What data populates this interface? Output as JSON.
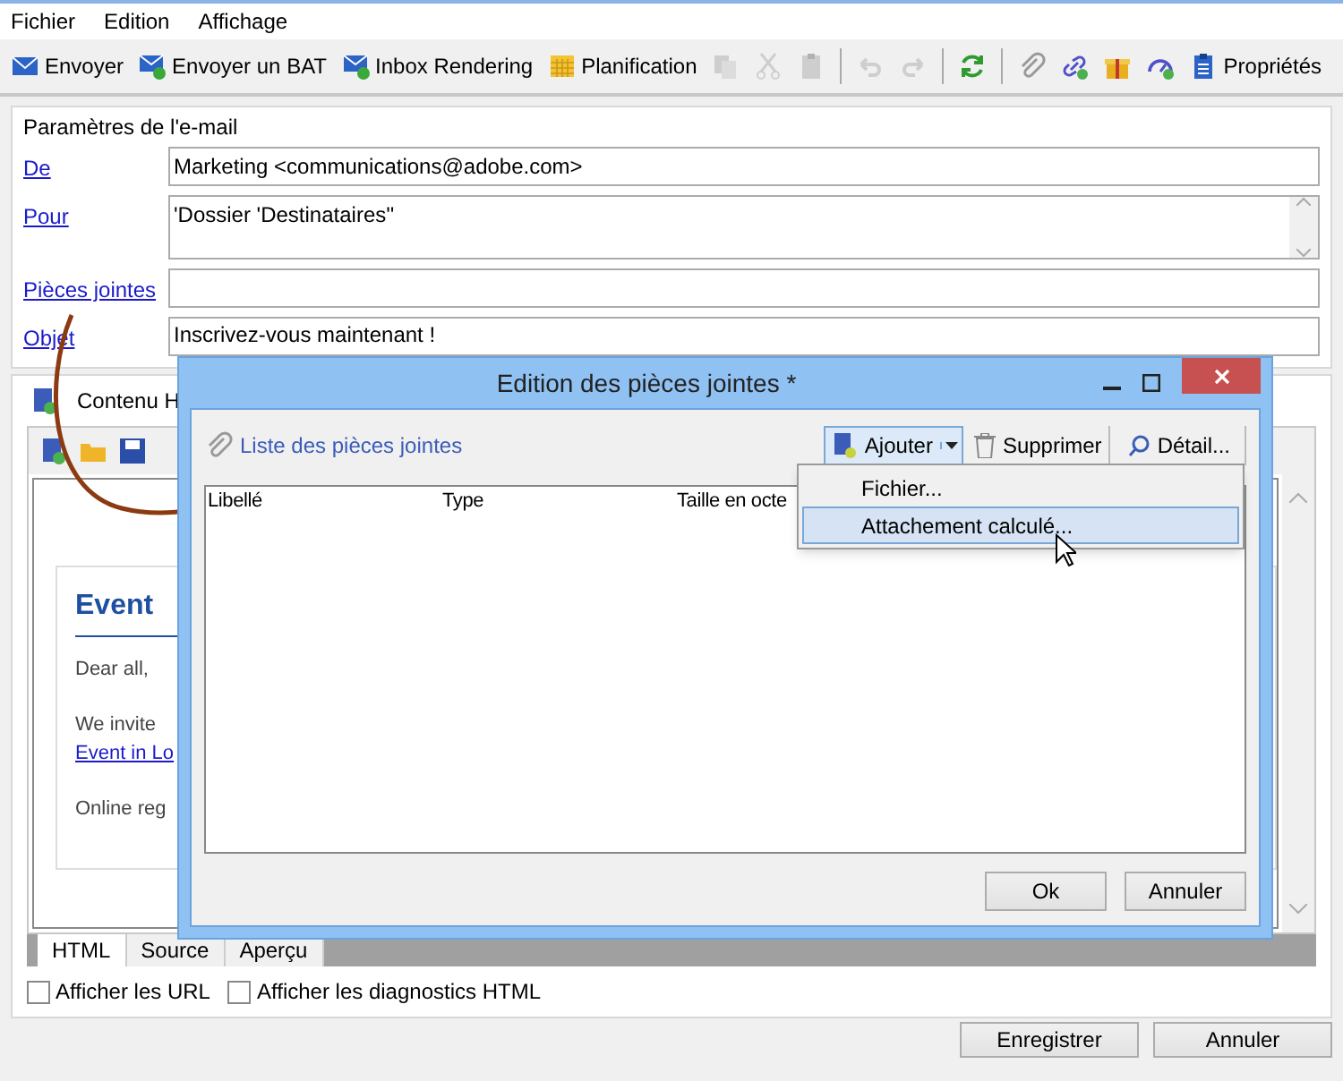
{
  "menu": [
    "Fichier",
    "Edition",
    "Affichage"
  ],
  "toolbar": [
    {
      "kind": "text",
      "label": "Envoyer"
    },
    {
      "kind": "text",
      "label": "Envoyer un BAT"
    },
    {
      "kind": "text",
      "label": "Inbox Rendering"
    },
    {
      "kind": "text",
      "label": "Planification"
    },
    {
      "kind": "icon",
      "disabled": true
    },
    {
      "kind": "icon",
      "disabled": true
    },
    {
      "kind": "icon",
      "disabled": true
    },
    {
      "kind": "sep"
    },
    {
      "kind": "icon",
      "disabled": true
    },
    {
      "kind": "icon",
      "disabled": true
    },
    {
      "kind": "sep"
    },
    {
      "kind": "icon",
      "disabled": false
    },
    {
      "kind": "sep"
    },
    {
      "kind": "icon",
      "disabled": false
    },
    {
      "kind": "icon",
      "disabled": false
    },
    {
      "kind": "icon",
      "disabled": false
    },
    {
      "kind": "icon",
      "disabled": false
    },
    {
      "kind": "text",
      "label": "Propriétés"
    }
  ],
  "params": {
    "title": "Paramètres de l'e-mail",
    "fields": [
      {
        "label": "De",
        "kind": "single",
        "value": "Marketing <communications@adobe.com>"
      },
      {
        "label": "Pour",
        "kind": "multi",
        "value": "'Dossier 'Destinataires''"
      },
      {
        "label": "Pièces jointes",
        "kind": "single"
      },
      {
        "label": "Objet",
        "kind": "single",
        "value": "Inscrivez-vous maintenant !"
      }
    ]
  },
  "content": {
    "tab": "Contenu H",
    "heading": "Event",
    "lines": [
      {
        "kind": "text",
        "text": "Dear all,"
      },
      {
        "kind": "text",
        "text": "We  invite"
      },
      {
        "kind": "link",
        "text": "Event in Lo"
      },
      {
        "kind": "text",
        "text": "Online reg"
      }
    ]
  },
  "view_tabs": [
    {
      "label": "HTML",
      "selected": true
    },
    {
      "label": "Source",
      "selected": false
    },
    {
      "label": "Aperçu",
      "selected": false
    }
  ],
  "checkboxes": [
    {
      "label": "Afficher les URL",
      "checked": false
    },
    {
      "label": "Afficher les diagnostics HTML",
      "checked": false
    }
  ],
  "buttons": [
    "Enregistrer",
    "Annuler"
  ],
  "dialog": {
    "title": "Edition des pièces jointes *",
    "list_label": "Liste des pièces jointes",
    "actions": [
      "Ajouter",
      "Supprimer",
      "Détail..."
    ],
    "columns": [
      "Libellé",
      "Type",
      "Taille en octe"
    ],
    "menu": [
      {
        "label": "Fichier...",
        "selected": false
      },
      {
        "label": "Attachement calculé...",
        "selected": true
      }
    ],
    "buttons": [
      "Ok",
      "Annuler"
    ]
  }
}
